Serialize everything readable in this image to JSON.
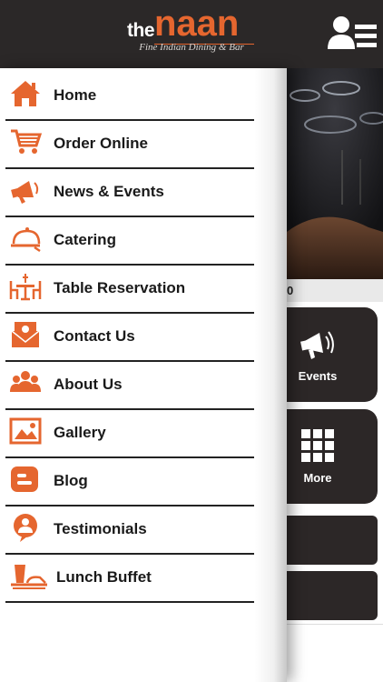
{
  "header": {
    "logo": {
      "the": "the",
      "naan": "naan",
      "tagline": "Fine Indian Dining & Bar"
    },
    "menu_icon": "user-menu-icon"
  },
  "accent_color": "#e5662f",
  "drawer": {
    "items": [
      {
        "label": "Home",
        "icon": "home-icon"
      },
      {
        "label": "Order Online",
        "icon": "cart-icon"
      },
      {
        "label": "News & Events",
        "icon": "megaphone-icon"
      },
      {
        "label": "Catering",
        "icon": "cloche-icon"
      },
      {
        "label": "Table Reservation",
        "icon": "table-icon"
      },
      {
        "label": "Contact Us",
        "icon": "envelope-icon"
      },
      {
        "label": "About Us",
        "icon": "people-icon"
      },
      {
        "label": "Gallery",
        "icon": "image-icon"
      },
      {
        "label": "Blog",
        "icon": "blog-icon"
      },
      {
        "label": "Testimonials",
        "icon": "testimonial-icon"
      },
      {
        "label": "Lunch Buffet",
        "icon": "buffet-icon"
      }
    ]
  },
  "background": {
    "strip_text": "0",
    "tiles": [
      {
        "label": "Events",
        "icon": "megaphone-icon"
      },
      {
        "label": "More",
        "icon": "grid-icon"
      }
    ]
  }
}
